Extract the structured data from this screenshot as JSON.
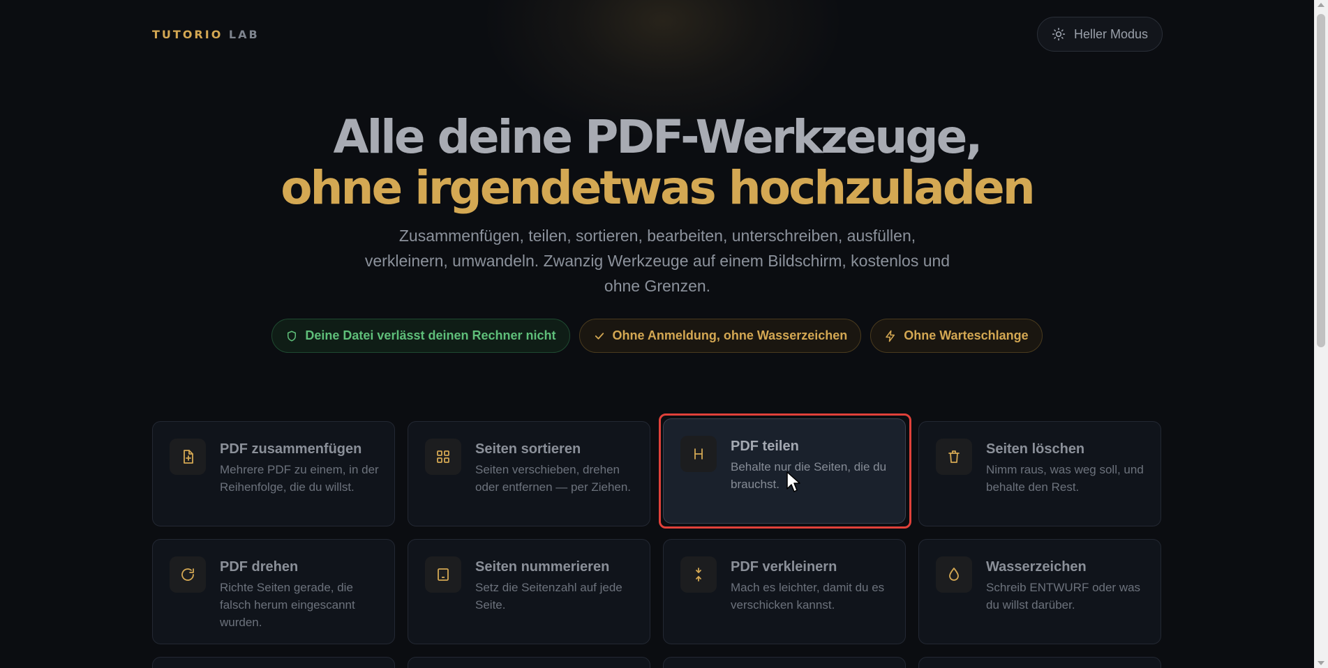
{
  "brand": {
    "logo_main": "TUTORIO",
    "logo_accent": "LAB"
  },
  "header": {
    "mode_toggle_label": "Heller Modus",
    "mode_icon": "sun-icon"
  },
  "hero": {
    "title_line1": "Alle deine PDF-Werkzeuge,",
    "title_line2": "ohne irgendetwas hochzuladen",
    "subtitle": "Zusammenfügen, teilen, sortieren, bearbeiten, unterschreiben, ausfüllen, verkleinern, umwandeln. Zwanzig Werkzeuge auf einem Bildschirm, kostenlos und ohne Grenzen."
  },
  "badges": [
    {
      "label": "Deine Datei verlässt deinen Rechner nicht",
      "icon": "shield-icon",
      "color": "#5fbf7a"
    },
    {
      "label": "Ohne Anmeldung, ohne Wasserzeichen",
      "icon": "check-icon",
      "color": "#d4a853"
    },
    {
      "label": "Ohne Warteschlange",
      "icon": "lightning-icon",
      "color": "#d4a853"
    }
  ],
  "tools": [
    {
      "title": "PDF zusammenfügen",
      "desc": "Mehrere PDF zu einem, in der Reihenfolge, die du willst.",
      "icon": "merge-file-icon"
    },
    {
      "title": "Seiten sortieren",
      "desc": "Seiten verschieben, drehen oder entfernen — per Ziehen.",
      "icon": "grid-icon"
    },
    {
      "title": "PDF teilen",
      "desc": "Behalte nur die Seiten, die du brauchst.",
      "icon": "split-icon"
    },
    {
      "title": "Seiten löschen",
      "desc": "Nimm raus, was weg soll, und behalte den Rest.",
      "icon": "trash-icon"
    },
    {
      "title": "PDF drehen",
      "desc": "Richte Seiten gerade, die falsch herum eingescannt wurden.",
      "icon": "rotate-icon"
    },
    {
      "title": "Seiten nummerieren",
      "desc": "Setz die Seitenzahl auf jede Seite.",
      "icon": "page-number-icon"
    },
    {
      "title": "PDF verkleinern",
      "desc": "Mach es leichter, damit du es verschicken kannst.",
      "icon": "compress-icon"
    },
    {
      "title": "Wasserzeichen",
      "desc": "Schreib ENTWURF oder was du willst darüber.",
      "icon": "droplet-icon"
    }
  ],
  "colors": {
    "accent": "#d4a853",
    "background": "#0b0d11",
    "highlight": "#e0413a",
    "success": "#5fbf7a"
  }
}
